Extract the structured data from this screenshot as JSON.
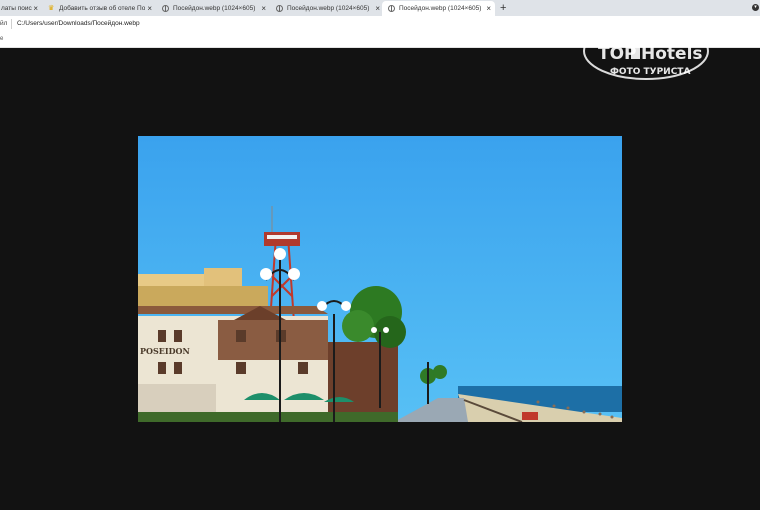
{
  "tabs": [
    {
      "title": "латы поис",
      "icon": "globe-icon",
      "active": false
    },
    {
      "title": "Добавить отзыв об отеле Посей",
      "icon": "crown-icon",
      "active": false
    },
    {
      "title": "Посейдон.webp (1024×605)",
      "icon": "globe-icon",
      "active": false
    },
    {
      "title": "Посейдон.webp (1024×605)",
      "icon": "globe-icon",
      "active": false
    },
    {
      "title": "Посейдон.webp (1024×605)",
      "icon": "globe-icon",
      "active": true
    }
  ],
  "address_bar": {
    "prefix": "йл",
    "url": "C:/Users/user/Downloads/Посейдон.webp"
  },
  "bookmarks_fragment": "е",
  "image": {
    "sign_text": "POSEIDON"
  },
  "watermark": {
    "brand_top": "TOP",
    "brand_hotels": "Hotels",
    "subtitle": "ФОТО ТУРИСТА"
  },
  "colors": {
    "viewer_bg": "#121212",
    "sky": "#3aa8f0",
    "sea": "#1d6fa6"
  }
}
